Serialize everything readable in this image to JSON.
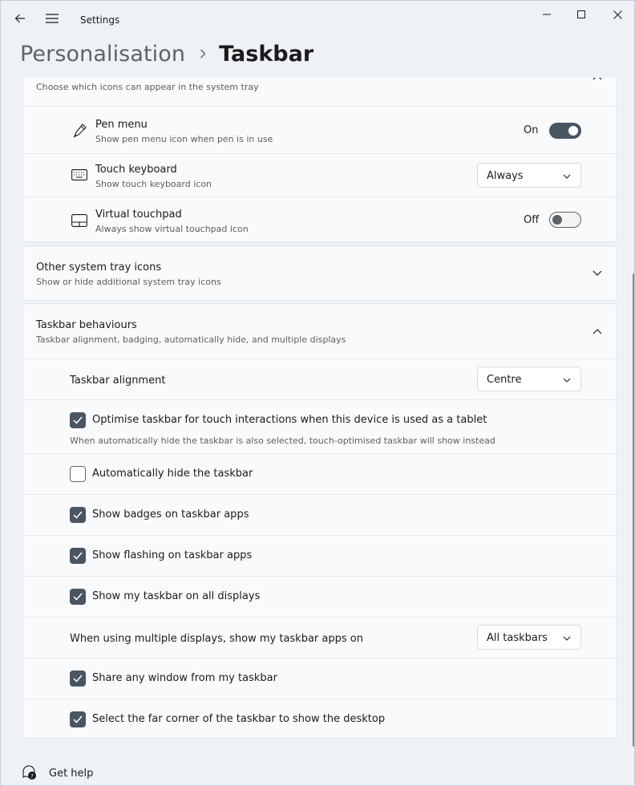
{
  "window": {
    "title": "Settings"
  },
  "header": {
    "parent": "Personalisation",
    "current": "Taskbar"
  },
  "tray_card": {
    "subtitle": "Choose which icons can appear in the system tray",
    "items": [
      {
        "title": "Pen menu",
        "subtitle": "Show pen menu icon when pen is in use",
        "state_label": "On"
      },
      {
        "title": "Touch keyboard",
        "subtitle": "Show touch keyboard icon",
        "dropdown": "Always"
      },
      {
        "title": "Virtual touchpad",
        "subtitle": "Always show virtual touchpad icon",
        "state_label": "Off"
      }
    ]
  },
  "other_tray": {
    "title": "Other system tray icons",
    "subtitle": "Show or hide additional system tray icons"
  },
  "behaviours": {
    "title": "Taskbar behaviours",
    "subtitle": "Taskbar alignment, badging, automatically hide, and multiple displays",
    "alignment_label": "Taskbar alignment",
    "alignment_value": "Centre",
    "optimise_label": "Optimise taskbar for touch interactions when this device is used as a tablet",
    "optimise_note": "When automatically hide the taskbar is also selected, touch-optimised taskbar will show instead",
    "autohide_label": "Automatically hide the taskbar",
    "badges_label": "Show badges on taskbar apps",
    "flashing_label": "Show flashing on taskbar apps",
    "alldisplays_label": "Show my taskbar on all displays",
    "multi_label": "When using multiple displays, show my taskbar apps on",
    "multi_value": "All taskbars",
    "share_label": "Share any window from my taskbar",
    "corner_label": "Select the far corner of the taskbar to show the desktop"
  },
  "footer": {
    "help_label": "Get help"
  },
  "colors": {
    "accent": "#4a5563",
    "background": "#eef2f7",
    "card": "#f9fafc"
  },
  "icons": [
    "back-arrow-icon",
    "hamburger-icon",
    "minimize-icon",
    "maximize-icon",
    "close-icon",
    "chevron-right-icon",
    "pen-icon",
    "keyboard-icon",
    "touchpad-icon",
    "chevron-down-icon",
    "chevron-up-icon",
    "checkmark-icon",
    "help-icon"
  ]
}
